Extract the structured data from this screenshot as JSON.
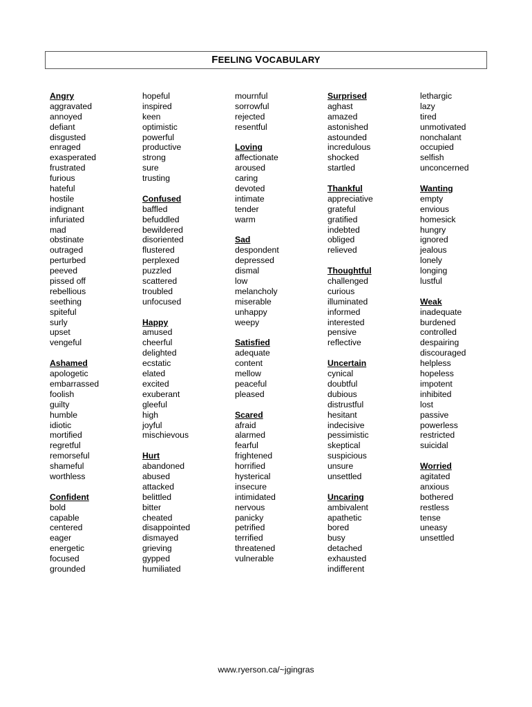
{
  "title": "FEELING VOCABULARY",
  "title_parts": [
    {
      "big": "F",
      "small": "EELING "
    },
    {
      "big": "V",
      "small": "OCABULARY"
    }
  ],
  "columns": [
    [
      {
        "type": "heading",
        "text": "Angry"
      },
      {
        "type": "word",
        "text": "aggravated"
      },
      {
        "type": "word",
        "text": "annoyed"
      },
      {
        "type": "word",
        "text": "defiant"
      },
      {
        "type": "word",
        "text": "disgusted"
      },
      {
        "type": "word",
        "text": "enraged"
      },
      {
        "type": "word",
        "text": "exasperated"
      },
      {
        "type": "word",
        "text": "frustrated"
      },
      {
        "type": "word",
        "text": "furious"
      },
      {
        "type": "word",
        "text": "hateful"
      },
      {
        "type": "word",
        "text": "hostile"
      },
      {
        "type": "word",
        "text": "indignant"
      },
      {
        "type": "word",
        "text": "infuriated"
      },
      {
        "type": "word",
        "text": "mad"
      },
      {
        "type": "word",
        "text": "obstinate"
      },
      {
        "type": "word",
        "text": "outraged"
      },
      {
        "type": "word",
        "text": "perturbed"
      },
      {
        "type": "word",
        "text": "peeved"
      },
      {
        "type": "word",
        "text": "pissed off"
      },
      {
        "type": "word",
        "text": "rebellious"
      },
      {
        "type": "word",
        "text": "seething"
      },
      {
        "type": "word",
        "text": "spiteful"
      },
      {
        "type": "word",
        "text": "surly"
      },
      {
        "type": "word",
        "text": "upset"
      },
      {
        "type": "word",
        "text": "vengeful"
      },
      {
        "type": "gap"
      },
      {
        "type": "heading",
        "text": "Ashamed"
      },
      {
        "type": "word",
        "text": "apologetic"
      },
      {
        "type": "word",
        "text": "embarrassed"
      },
      {
        "type": "word",
        "text": "foolish"
      },
      {
        "type": "word",
        "text": "guilty"
      },
      {
        "type": "word",
        "text": "humble"
      },
      {
        "type": "word",
        "text": "idiotic"
      },
      {
        "type": "word",
        "text": "mortified"
      },
      {
        "type": "word",
        "text": "regretful"
      },
      {
        "type": "word",
        "text": "remorseful"
      },
      {
        "type": "word",
        "text": "shameful"
      },
      {
        "type": "word",
        "text": "worthless"
      },
      {
        "type": "gap"
      },
      {
        "type": "heading",
        "text": "Confident"
      },
      {
        "type": "word",
        "text": "bold"
      },
      {
        "type": "word",
        "text": "capable"
      },
      {
        "type": "word",
        "text": "centered"
      },
      {
        "type": "word",
        "text": "eager"
      },
      {
        "type": "word",
        "text": "energetic"
      },
      {
        "type": "word",
        "text": "focused"
      },
      {
        "type": "word",
        "text": "grounded"
      }
    ],
    [
      {
        "type": "word",
        "text": "hopeful"
      },
      {
        "type": "word",
        "text": "inspired"
      },
      {
        "type": "word",
        "text": "keen"
      },
      {
        "type": "word",
        "text": "optimistic"
      },
      {
        "type": "word",
        "text": "powerful"
      },
      {
        "type": "word",
        "text": "productive"
      },
      {
        "type": "word",
        "text": "strong"
      },
      {
        "type": "word",
        "text": "sure"
      },
      {
        "type": "word",
        "text": "trusting"
      },
      {
        "type": "gap"
      },
      {
        "type": "heading",
        "text": "Confused"
      },
      {
        "type": "word",
        "text": "baffled"
      },
      {
        "type": "word",
        "text": "befuddled"
      },
      {
        "type": "word",
        "text": "bewildered"
      },
      {
        "type": "word",
        "text": "disoriented"
      },
      {
        "type": "word",
        "text": "flustered"
      },
      {
        "type": "word",
        "text": "perplexed"
      },
      {
        "type": "word",
        "text": "puzzled"
      },
      {
        "type": "word",
        "text": "scattered"
      },
      {
        "type": "word",
        "text": "troubled"
      },
      {
        "type": "word",
        "text": "unfocused"
      },
      {
        "type": "gap"
      },
      {
        "type": "heading",
        "text": "Happy"
      },
      {
        "type": "word",
        "text": "amused"
      },
      {
        "type": "word",
        "text": "cheerful"
      },
      {
        "type": "word",
        "text": "delighted"
      },
      {
        "type": "word",
        "text": "ecstatic"
      },
      {
        "type": "word",
        "text": "elated"
      },
      {
        "type": "word",
        "text": "excited"
      },
      {
        "type": "word",
        "text": "exuberant"
      },
      {
        "type": "word",
        "text": "gleeful"
      },
      {
        "type": "word",
        "text": "high"
      },
      {
        "type": "word",
        "text": "joyful"
      },
      {
        "type": "word",
        "text": "mischievous"
      },
      {
        "type": "gap"
      },
      {
        "type": "heading",
        "text": "Hurt"
      },
      {
        "type": "word",
        "text": "abandoned"
      },
      {
        "type": "word",
        "text": "abused"
      },
      {
        "type": "word",
        "text": "attacked"
      },
      {
        "type": "word",
        "text": "belittled"
      },
      {
        "type": "word",
        "text": "bitter"
      },
      {
        "type": "word",
        "text": "cheated"
      },
      {
        "type": "word",
        "text": "disappointed"
      },
      {
        "type": "word",
        "text": "dismayed"
      },
      {
        "type": "word",
        "text": "grieving"
      },
      {
        "type": "word",
        "text": "gypped"
      },
      {
        "type": "word",
        "text": "humiliated"
      }
    ],
    [
      {
        "type": "word",
        "text": "mournful"
      },
      {
        "type": "word",
        "text": "sorrowful"
      },
      {
        "type": "word",
        "text": "rejected"
      },
      {
        "type": "word",
        "text": "resentful"
      },
      {
        "type": "gap"
      },
      {
        "type": "heading",
        "text": "Loving"
      },
      {
        "type": "word",
        "text": "affectionate"
      },
      {
        "type": "word",
        "text": "aroused"
      },
      {
        "type": "word",
        "text": "caring"
      },
      {
        "type": "word",
        "text": "devoted"
      },
      {
        "type": "word",
        "text": "intimate"
      },
      {
        "type": "word",
        "text": "tender"
      },
      {
        "type": "word",
        "text": "warm"
      },
      {
        "type": "gap"
      },
      {
        "type": "heading",
        "text": "Sad"
      },
      {
        "type": "word",
        "text": "despondent"
      },
      {
        "type": "word",
        "text": "depressed"
      },
      {
        "type": "word",
        "text": "dismal"
      },
      {
        "type": "word",
        "text": "low"
      },
      {
        "type": "word",
        "text": "melancholy"
      },
      {
        "type": "word",
        "text": "miserable"
      },
      {
        "type": "word",
        "text": "unhappy"
      },
      {
        "type": "word",
        "text": "weepy"
      },
      {
        "type": "gap"
      },
      {
        "type": "heading",
        "text": "Satisfied"
      },
      {
        "type": "word",
        "text": "adequate"
      },
      {
        "type": "word",
        "text": "content"
      },
      {
        "type": "word",
        "text": "mellow"
      },
      {
        "type": "word",
        "text": "peaceful"
      },
      {
        "type": "word",
        "text": "pleased"
      },
      {
        "type": "gap"
      },
      {
        "type": "heading",
        "text": "Scared"
      },
      {
        "type": "word",
        "text": "afraid"
      },
      {
        "type": "word",
        "text": "alarmed"
      },
      {
        "type": "word",
        "text": "fearful"
      },
      {
        "type": "word",
        "text": "frightened"
      },
      {
        "type": "word",
        "text": "horrified"
      },
      {
        "type": "word",
        "text": "hysterical"
      },
      {
        "type": "word",
        "text": "insecure"
      },
      {
        "type": "word",
        "text": "intimidated"
      },
      {
        "type": "word",
        "text": "nervous"
      },
      {
        "type": "word",
        "text": "panicky"
      },
      {
        "type": "word",
        "text": "petrified"
      },
      {
        "type": "word",
        "text": "terrified"
      },
      {
        "type": "word",
        "text": "threatened"
      },
      {
        "type": "word",
        "text": "vulnerable"
      }
    ],
    [
      {
        "type": "heading",
        "text": "Surprised"
      },
      {
        "type": "word",
        "text": "aghast"
      },
      {
        "type": "word",
        "text": "amazed"
      },
      {
        "type": "word",
        "text": "astonished"
      },
      {
        "type": "word",
        "text": "astounded"
      },
      {
        "type": "word",
        "text": "incredulous"
      },
      {
        "type": "word",
        "text": "shocked"
      },
      {
        "type": "word",
        "text": "startled"
      },
      {
        "type": "gap"
      },
      {
        "type": "heading",
        "text": "Thankful"
      },
      {
        "type": "word",
        "text": "appreciative"
      },
      {
        "type": "word",
        "text": "grateful"
      },
      {
        "type": "word",
        "text": "gratified"
      },
      {
        "type": "word",
        "text": "indebted"
      },
      {
        "type": "word",
        "text": "obliged"
      },
      {
        "type": "word",
        "text": "relieved"
      },
      {
        "type": "gap"
      },
      {
        "type": "heading",
        "text": "Thoughtful"
      },
      {
        "type": "word",
        "text": "challenged"
      },
      {
        "type": "word",
        "text": "curious"
      },
      {
        "type": "word",
        "text": "illuminated"
      },
      {
        "type": "word",
        "text": "informed"
      },
      {
        "type": "word",
        "text": "interested"
      },
      {
        "type": "word",
        "text": "pensive"
      },
      {
        "type": "word",
        "text": "reflective"
      },
      {
        "type": "gap"
      },
      {
        "type": "heading",
        "text": "Uncertain"
      },
      {
        "type": "word",
        "text": "cynical"
      },
      {
        "type": "word",
        "text": "doubtful"
      },
      {
        "type": "word",
        "text": "dubious"
      },
      {
        "type": "word",
        "text": "distrustful"
      },
      {
        "type": "word",
        "text": "hesitant"
      },
      {
        "type": "word",
        "text": "indecisive"
      },
      {
        "type": "word",
        "text": "pessimistic"
      },
      {
        "type": "word",
        "text": "skeptical"
      },
      {
        "type": "word",
        "text": "suspicious"
      },
      {
        "type": "word",
        "text": "unsure"
      },
      {
        "type": "word",
        "text": "unsettled"
      },
      {
        "type": "gap"
      },
      {
        "type": "heading",
        "text": "Uncaring"
      },
      {
        "type": "word",
        "text": "ambivalent"
      },
      {
        "type": "word",
        "text": "apathetic"
      },
      {
        "type": "word",
        "text": "bored"
      },
      {
        "type": "word",
        "text": "busy"
      },
      {
        "type": "word",
        "text": "detached"
      },
      {
        "type": "word",
        "text": "exhausted"
      },
      {
        "type": "word",
        "text": "indifferent"
      }
    ],
    [
      {
        "type": "word",
        "text": "lethargic"
      },
      {
        "type": "word",
        "text": "lazy"
      },
      {
        "type": "word",
        "text": "tired"
      },
      {
        "type": "word",
        "text": "unmotivated"
      },
      {
        "type": "word",
        "text": "nonchalant"
      },
      {
        "type": "word",
        "text": "occupied"
      },
      {
        "type": "word",
        "text": "selfish"
      },
      {
        "type": "word",
        "text": "unconcerned"
      },
      {
        "type": "gap"
      },
      {
        "type": "heading",
        "text": "Wanting"
      },
      {
        "type": "word",
        "text": "empty"
      },
      {
        "type": "word",
        "text": "envious"
      },
      {
        "type": "word",
        "text": "homesick"
      },
      {
        "type": "word",
        "text": "hungry"
      },
      {
        "type": "word",
        "text": "ignored"
      },
      {
        "type": "word",
        "text": "jealous"
      },
      {
        "type": "word",
        "text": "lonely"
      },
      {
        "type": "word",
        "text": "longing"
      },
      {
        "type": "word",
        "text": "lustful"
      },
      {
        "type": "gap"
      },
      {
        "type": "heading",
        "text": "Weak"
      },
      {
        "type": "word",
        "text": "inadequate"
      },
      {
        "type": "word",
        "text": "burdened"
      },
      {
        "type": "word",
        "text": "controlled"
      },
      {
        "type": "word",
        "text": "despairing"
      },
      {
        "type": "word",
        "text": "discouraged"
      },
      {
        "type": "word",
        "text": "helpless"
      },
      {
        "type": "word",
        "text": "hopeless"
      },
      {
        "type": "word",
        "text": "impotent"
      },
      {
        "type": "word",
        "text": "inhibited"
      },
      {
        "type": "word",
        "text": "lost"
      },
      {
        "type": "word",
        "text": "passive"
      },
      {
        "type": "word",
        "text": "powerless"
      },
      {
        "type": "word",
        "text": "restricted"
      },
      {
        "type": "word",
        "text": "suicidal"
      },
      {
        "type": "gap"
      },
      {
        "type": "heading",
        "text": "Worried"
      },
      {
        "type": "word",
        "text": "agitated"
      },
      {
        "type": "word",
        "text": "anxious"
      },
      {
        "type": "word",
        "text": "bothered"
      },
      {
        "type": "word",
        "text": "restless"
      },
      {
        "type": "word",
        "text": "tense"
      },
      {
        "type": "word",
        "text": "uneasy"
      },
      {
        "type": "word",
        "text": "unsettled"
      }
    ]
  ],
  "footer": "www.ryerson.ca/~jgingras"
}
